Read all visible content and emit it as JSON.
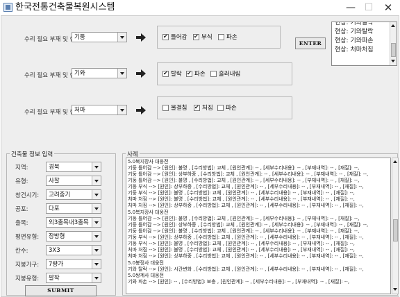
{
  "window": {
    "title": "한국전통건축물복원시스템",
    "minimize_symbol": "—",
    "maximize_symbol": "☐",
    "close_symbol": "✕"
  },
  "repair_rows": [
    {
      "label": "수리 필요 부재 및 현상:",
      "member": "기둥",
      "phenomena": [
        {
          "label": "틀어감",
          "checked": true
        },
        {
          "label": "부식",
          "checked": true
        },
        {
          "label": "파손",
          "checked": false
        }
      ]
    },
    {
      "label": "수리 필요 부재 및 현상:",
      "member": "기와",
      "phenomena": [
        {
          "label": "탈락",
          "checked": true
        },
        {
          "label": "파손",
          "checked": true
        },
        {
          "label": "흘러내림",
          "checked": false
        }
      ]
    },
    {
      "label": "수리 필요 부재 및 현상:",
      "member": "처마",
      "phenomena": [
        {
          "label": "물결침",
          "checked": false
        },
        {
          "label": "처짐",
          "checked": true
        },
        {
          "label": "파손",
          "checked": false
        }
      ]
    }
  ],
  "enter_button": "ENTER",
  "status_list": [
    "현상: 기와탈락",
    "현상: 기와파손",
    "현상: 처마처짐"
  ],
  "building_info": {
    "title": "건축물 정보 입력",
    "fields": [
      {
        "label": "지역:",
        "value": "경북"
      },
      {
        "label": "유형:",
        "value": "사찰"
      },
      {
        "label": "창건시기:",
        "value": "고려중기"
      },
      {
        "label": "공포:",
        "value": "다포"
      },
      {
        "label": "출목:",
        "value": "외3출목내3출목"
      },
      {
        "label": "평면유형:",
        "value": "장방형"
      },
      {
        "label": "칸수:",
        "value": "3X3"
      },
      {
        "label": "지붕가구:",
        "value": "7량가"
      },
      {
        "label": "지붕유형:",
        "value": "팔작"
      }
    ],
    "submit": "SUBMIT"
  },
  "case_panel": {
    "title": "사례",
    "lines": [
      "5.0복지장사 대웅전",
      "기둥 틀어감 --> [원인]: 불명 , [수리방법]: 교체 , [원인관계]: -- , [세부수리내용]: -- , [부재내역]: -- , [재질]: --,",
      "기둥 틀어감 --> [원인]: 상부하중 , [수리방법]: 교체 , [원인관계]: -- , [세부수리내용]: -- , [부재내역]: -- , [재질]: --,",
      "기둥 틀어감 --> [원인]: 불명 , [수리방법]: 교체 , [원인관계]: -- , [세부수리내용]: -- , [부재내역]: -- , [재질]: --,",
      "기둥 부식 --> [원인]: 상부하중 , [수리방법]: 교체 , [원인관계]: -- , [세부수리내용]: -- , [부재내역]: -- , [재질]: --,",
      "기둥 부식 --> [원인]: 불명 , [수리방법]: 교체 , [원인관계]: -- , [세부수리내용]: -- , [부재내역]: -- , [재질]: --,",
      "처마 처짐 --> [원인]: 불명 , [수리방법]: 교체 , [원인관계]: -- , [세부수리내용]: -- , [부재내역]: -- , [재질]: --,",
      "처마 처짐 --> [원인]: 상부하중 , [수리방법]: 교체 , [원인관계]: -- , [세부수리내용]: -- , [부재내역]: -- , [재질]: --,",
      "5.0복지장사 대웅전",
      "기둥 틀어감 --> [원인]: 불명 , [수리방법]: 교체 , [원인관계]: -- , [세부수리내용]: -- , [부재내역]: -- , [재질]: --,",
      "기둥 틀어감 --> [원인]: 상부하중 , [수리방법]: 교체 , [원인관계]: -- , [세부수리내용]: -- , [부재내역]: -- , [재질]: --,",
      "기둥 틀어감 --> [원인]: 불명 , [수리방법]: 교체 , [원인관계]: -- , [세부수리내용]: -- , [부재내역]: -- , [재질]: --,",
      "기둥 부식 --> [원인]: 상부하중 , [수리방법]: 교체 , [원인관계]: -- , [세부수리내용]: -- , [부재내역]: -- , [재질]: --,",
      "기둥 부식 --> [원인]: 불명 , [수리방법]: 교체 , [원인관계]: -- , [세부수리내용]: -- , [부재내역]: -- , [재질]: --,",
      "처마 처짐 --> [원인]: 불명 , [수리방법]: 교체 , [원인관계]: -- , [세부수리내용]: -- , [부재내역]: -- , [재질]: --,",
      "처마 처짐 --> [원인]: 상부하중 , [수리방법]: 교체 , [원인관계]: -- , [세부수리내용]: -- , [부재내역]: -- , [재질]: --,",
      "5.0봉정사 대웅전",
      "기와 탈락 --> [원인]: 시간변화 , [수리방법]: 교체 , [원인관계]: -- , [세부수리내용]: -- , [부재내역]: -- , [재질]: --,",
      "5.0쌍계사 대웅전",
      "기와 파손 --> [원인]: -- , [수리방법]: 보충 , [원인관계]: -- , [세부수리내용]: -- , [부재내역]: -- , [재질]: --,"
    ]
  }
}
